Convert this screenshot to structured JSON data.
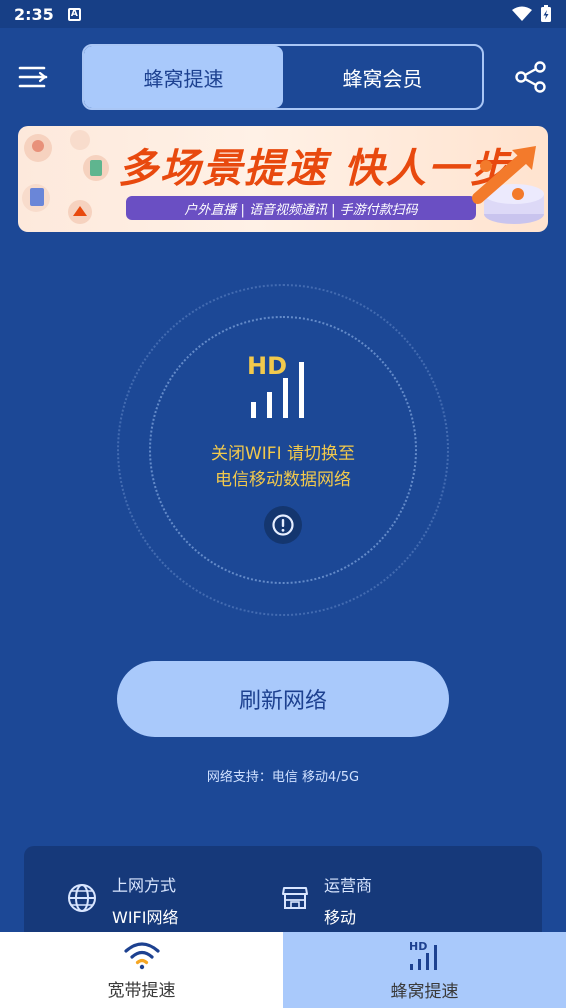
{
  "status_bar": {
    "time": "2:35",
    "notif_icon": "A"
  },
  "header": {
    "menu_icon": "menu-icon",
    "share_icon": "share-icon",
    "tabs": [
      {
        "label": "蜂窝提速",
        "active": true
      },
      {
        "label": "蜂窝会员",
        "active": false
      }
    ]
  },
  "banner": {
    "headline": "多场景提速 快人一步",
    "subline": "户外直播 | 语音视频通讯 | 手游付款扫码"
  },
  "status_panel": {
    "hd_label": "HD",
    "message_line1": "关闭WIFI 请切换至",
    "message_line2": "电信移动数据网络",
    "info_icon": "info-icon"
  },
  "refresh_button": {
    "label": "刷新网络"
  },
  "support_text": "网络支持：电信 移动4/5G",
  "info_card": {
    "access_mode": {
      "label": "上网方式",
      "value": "WIFI网络"
    },
    "carrier": {
      "label": "运营商",
      "value": "移动"
    }
  },
  "bottom_nav": [
    {
      "label": "宽带提速",
      "icon": "wifi-icon",
      "active": false
    },
    {
      "label": "蜂窝提速",
      "icon": "hd-signal-icon",
      "active": true
    }
  ],
  "colors": {
    "background": "#1c4896",
    "accent": "#a9c9fb",
    "warning_text": "#f2c94c",
    "banner_text": "#e8490e"
  }
}
